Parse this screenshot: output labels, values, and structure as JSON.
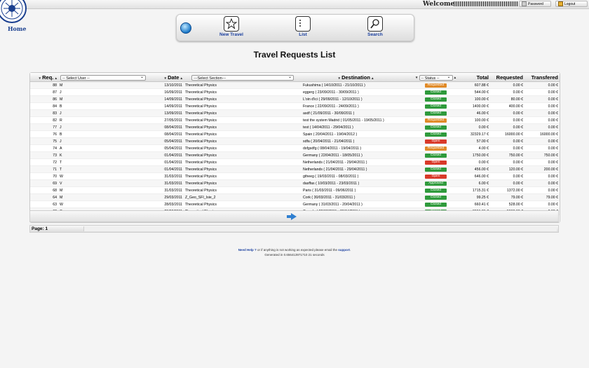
{
  "topbar": {
    "welcome": "Welcome",
    "password_btn": "Password",
    "logout_btn": "Logout"
  },
  "home_label": "Home",
  "menu": {
    "new_travel": "New Travel",
    "list": "List",
    "search": "Search"
  },
  "page_title": "Travel Requests List",
  "table": {
    "headers": {
      "req": "Req.",
      "user_select": "-- Select User --",
      "date": "Date",
      "section_select": "---Select Section---",
      "destination": "Destination",
      "status_select": "-- Status --",
      "total": "Total",
      "requested": "Requested",
      "transfered": "Transfered"
    },
    "rows": [
      {
        "req": "88",
        "user": "M",
        "date": "13/10/2011",
        "section": "Theoretical Physics",
        "dest": "Fukushima ( 14/10/2011 - 21/10/2011 )",
        "status": "Requested",
        "color": "orange",
        "total": "607.88 €",
        "requested": "0.00 €",
        "transfered": "0.00 €"
      },
      {
        "req": "87",
        "user": "J",
        "date": "16/09/2011",
        "section": "Theoretical Physics",
        "dest": "eggerg ( 23/09/2011 - 30/09/2011 )",
        "status": "Closed",
        "color": "green",
        "total": "544.00 €",
        "requested": "0.00 €",
        "transfered": "0.00 €"
      },
      {
        "req": "86",
        "user": "M",
        "date": "14/09/2011",
        "section": "Theoretical Physics",
        "dest": "L'oin d'ici ( 29/09/2011 - 12/10/2011 )",
        "status": "Closed",
        "color": "green",
        "total": "100.00 €",
        "requested": "80.00 €",
        "transfered": "0.00 €"
      },
      {
        "req": "84",
        "user": "B",
        "date": "14/09/2011",
        "section": "Theoretical Physics",
        "dest": "France ( 22/09/2011 - 24/09/2011 )",
        "status": "Closed",
        "color": "green",
        "total": "1400.00 €",
        "requested": "400.00 €",
        "transfered": "0.00 €"
      },
      {
        "req": "83",
        "user": "J",
        "date": "13/09/2011",
        "section": "Theoretical Physics",
        "dest": "asdf ( 21/09/2011 - 30/09/2011 )",
        "status": "Closed",
        "color": "green",
        "total": "46.00 €",
        "requested": "0.00 €",
        "transfered": "0.00 €"
      },
      {
        "req": "82",
        "user": "R",
        "date": "27/05/2011",
        "section": "Theoretical Physics",
        "dest": "test the system Madrid ( 01/05/2011 - 19/05/2011 )",
        "status": "Requested",
        "color": "orange",
        "total": "100.00 €",
        "requested": "0.00 €",
        "transfered": "0.00 €"
      },
      {
        "req": "77",
        "user": "J",
        "date": "08/04/2011",
        "section": "Theoretical Physics",
        "dest": "test ( 14/04/2011 - 29/04/2011 )",
        "status": "Closed",
        "color": "green",
        "total": "0.00 €",
        "requested": "0.00 €",
        "transfered": "0.00 €"
      },
      {
        "req": "76",
        "user": "B",
        "date": "08/04/2011",
        "section": "Theoretical Physics",
        "dest": "Spain ( 20/04/2011 - 19/04/2012 )",
        "status": "Closed",
        "color": "green",
        "total": "32329.17 €",
        "requested": "16000.00 €",
        "transfered": "16000.00 €"
      },
      {
        "req": "75",
        "user": "J",
        "date": "05/04/2011",
        "section": "Theoretical Physics",
        "dest": "sdfa ( 20/04/2011 - 21/04/2011 )",
        "status": "Open",
        "color": "red",
        "total": "57.00 €",
        "requested": "0.00 €",
        "transfered": "0.00 €"
      },
      {
        "req": "74",
        "user": "A",
        "date": "05/04/2011",
        "section": "Theoretical Physics",
        "dest": "dsfgsdfg ( 08/04/2011 - 19/04/2011 )",
        "status": "Requested",
        "color": "orange",
        "total": "4.00 €",
        "requested": "0.00 €",
        "transfered": "0.00 €"
      },
      {
        "req": "73",
        "user": "K",
        "date": "01/04/2011",
        "section": "Theoretical Physics",
        "dest": "Germany ( 22/04/2011 - 18/05/2011 )",
        "status": "Closed",
        "color": "green",
        "total": "1750.00 €",
        "requested": "750.00 €",
        "transfered": "750.00 €"
      },
      {
        "req": "72",
        "user": "T",
        "date": "01/04/2011",
        "section": "Theoretical Physics",
        "dest": "Netherlands ( 21/04/2011 - 29/04/2011 )",
        "status": "Open",
        "color": "red",
        "total": "0.00 €",
        "requested": "0.00 €",
        "transfered": "0.00 €"
      },
      {
        "req": "71",
        "user": "T",
        "date": "01/04/2011",
        "section": "Theoretical Physics",
        "dest": "Netherlands ( 21/04/2011 - 29/04/2011 )",
        "status": "Closed",
        "color": "green",
        "total": "456.00 €",
        "requested": "120.00 €",
        "transfered": "200.00 €"
      },
      {
        "req": "70",
        "user": "W",
        "date": "31/03/2011",
        "section": "Theoretical Physics",
        "dest": "gtheeg ( 19/03/2011 - 08/03/2011 )",
        "status": "Open",
        "color": "red",
        "total": "646.00 €",
        "requested": "0.00 €",
        "transfered": "0.00 €"
      },
      {
        "req": "69",
        "user": "V",
        "date": "31/03/2011",
        "section": "Theoretical Physics",
        "dest": "dasffas ( 10/03/2011 - 23/03/2011 )",
        "status": "Approved",
        "color": "green",
        "total": "6.00 €",
        "requested": "0.00 €",
        "transfered": "0.00 €"
      },
      {
        "req": "68",
        "user": "M",
        "date": "31/03/2011",
        "section": "Theoretical Physics",
        "dest": "Paris ( 31/03/2011 - 09/06/2011 )",
        "status": "Closed",
        "color": "green",
        "total": "1715.31 €",
        "requested": "1372.00 €",
        "transfered": "0.00 €"
      },
      {
        "req": "64",
        "user": "M",
        "date": "29/03/2011",
        "section": "Z_Geo_SFI_Isie_2",
        "dest": "Cork ( 30/03/2011 - 31/03/2011 )",
        "status": "Closed",
        "color": "green",
        "total": "99.25 €",
        "requested": "79.00 €",
        "transfered": "79.00 €"
      },
      {
        "req": "63",
        "user": "W",
        "date": "28/03/2011",
        "section": "Theoretical Physics",
        "dest": "Germany ( 31/03/2011 - 20/04/2011 )",
        "status": "Closed",
        "color": "green",
        "total": "660.41 €",
        "requested": "528.00 €",
        "transfered": "0.00 €"
      },
      {
        "req": "62",
        "user": "C",
        "date": "28/03/2011",
        "section": "Theoretical Physics",
        "dest": "Canada ( 28/03/2011 - 29/04/2011 )",
        "status": "Closed",
        "color": "green",
        "total": "6551.31 €",
        "requested": "5000.00 €",
        "transfered": "0.00 €"
      },
      {
        "req": "61",
        "user": "M",
        "date": "28/03/2011",
        "section": "Theoretical Physics",
        "dest": "Kildare ( 31/03/2011 - 01/04/2011 )",
        "status": "Closed",
        "color": "green",
        "total": "107.00 €",
        "requested": "80.00 €",
        "transfered": "0.00 €"
      }
    ]
  },
  "pager": {
    "page_label": "Page: 1"
  },
  "footer": {
    "need_help": "Need Help ?",
    "help_text": " or if anything is not working as expected please email the ",
    "support": "support",
    "period": ".",
    "generated": "Generated in 0.656413971710 21 seconds"
  },
  "colors": {
    "status_green": "#2f9a3c",
    "status_orange": "#e08a28",
    "status_red": "#d93a2a",
    "link_blue": "#1a3f9f"
  }
}
